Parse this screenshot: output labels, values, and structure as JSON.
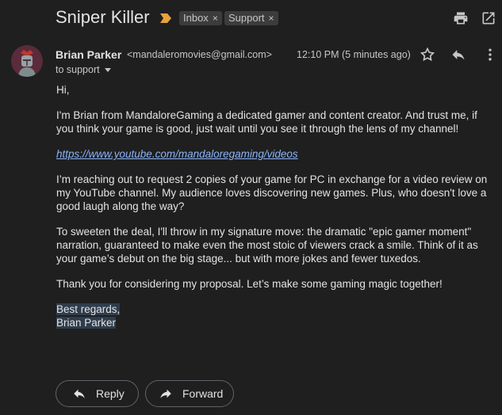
{
  "header": {
    "subject": "Sniper Killer",
    "labels": [
      {
        "text": "Inbox",
        "remove": "×"
      },
      {
        "text": "Support",
        "remove": "×"
      }
    ],
    "icons": [
      "importance-marker-icon",
      "print-icon",
      "open-in-new-window-icon"
    ]
  },
  "message": {
    "sender_name": "Brian Parker",
    "sender_email": "<mandaleromovies@gmail.com>",
    "timestamp": "12:10 PM (5 minutes ago)",
    "recipient": "to support",
    "actions_icons": [
      "star-icon",
      "reply-icon",
      "more-vert-icon"
    ]
  },
  "body": {
    "greeting": "Hi,",
    "para1": "I'm Brian from MandaloreGaming a dedicated gamer and content creator.  And trust me, if you think your game is good, just wait until you see it through the lens of my channel!",
    "link": "https://www.youtube.com/mandaloregaming/videos",
    "para2": "I’m reaching out to request 2 copies of your game for PC in exchange for a video review on my YouTube channel. My audience loves discovering new games. Plus, who doesn't love a good laugh along the way?",
    "para3": "To sweeten the deal, I'll throw in my signature move: the dramatic \"epic gamer moment\" narration, guaranteed to make even the most stoic of viewers crack a smile. Think of it as your game’s debut on the big stage... but with more jokes and fewer tuxedos.",
    "para4": "Thank you for considering my proposal. Let’s make some gaming magic together!",
    "signoff": "Best regards,",
    "signature": "Brian Parker"
  },
  "footer": {
    "reply_label": "Reply",
    "forward_label": "Forward"
  },
  "colors": {
    "background": "#1f1f1f",
    "text": "#e3e3e3",
    "link": "#8ab4f8",
    "importance": "#e6a23c",
    "chip": "#3c3c3c"
  }
}
